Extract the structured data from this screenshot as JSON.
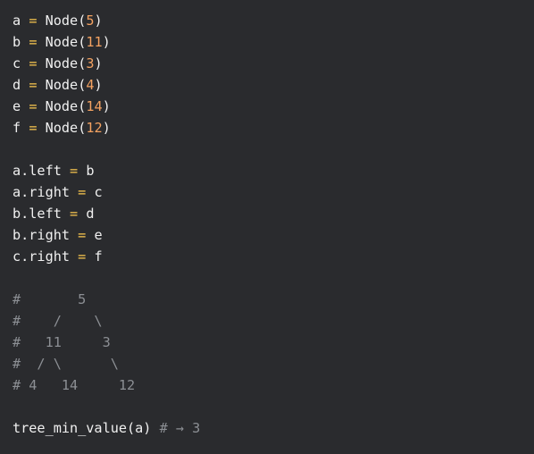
{
  "code": {
    "node_lines": [
      {
        "var": "a",
        "eq": "=",
        "call": "Node(",
        "arg": "5",
        "close": ")"
      },
      {
        "var": "b",
        "eq": "=",
        "call": "Node(",
        "arg": "11",
        "close": ")"
      },
      {
        "var": "c",
        "eq": "=",
        "call": "Node(",
        "arg": "3",
        "close": ")"
      },
      {
        "var": "d",
        "eq": "=",
        "call": "Node(",
        "arg": "4",
        "close": ")"
      },
      {
        "var": "e",
        "eq": "=",
        "call": "Node(",
        "arg": "14",
        "close": ")"
      },
      {
        "var": "f",
        "eq": "=",
        "call": "Node(",
        "arg": "12",
        "close": ")"
      }
    ],
    "link_lines": [
      {
        "lhs": "a.left",
        "eq": "=",
        "rhs": "b"
      },
      {
        "lhs": "a.right",
        "eq": "=",
        "rhs": "c"
      },
      {
        "lhs": "b.left",
        "eq": "=",
        "rhs": "d"
      },
      {
        "lhs": "b.right",
        "eq": "=",
        "rhs": "e"
      },
      {
        "lhs": "c.right",
        "eq": "=",
        "rhs": "f"
      }
    ],
    "comment_lines": [
      "#       5",
      "#    /    \\",
      "#   11     3",
      "#  / \\      \\",
      "# 4   14     12"
    ],
    "call_line": {
      "call": "tree_min_value(a)",
      "comment": "# → 3"
    }
  }
}
